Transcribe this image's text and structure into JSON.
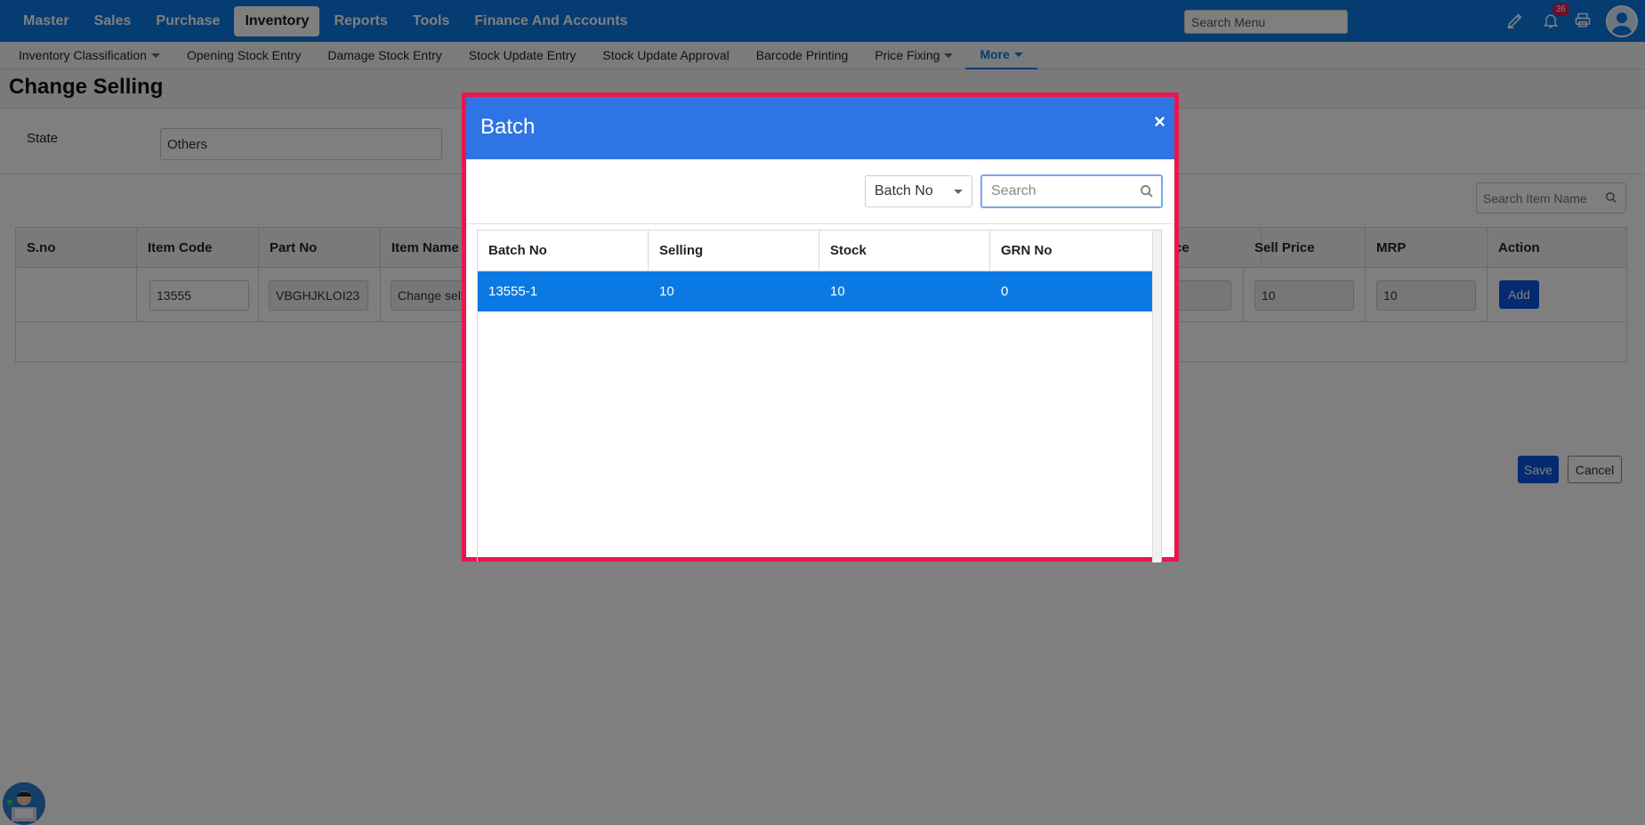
{
  "topnav": {
    "items": [
      "Master",
      "Sales",
      "Purchase",
      "Inventory",
      "Reports",
      "Tools",
      "Finance And Accounts"
    ],
    "active": "Inventory",
    "search_placeholder": "Search Menu",
    "notification_count": "36"
  },
  "subnav": {
    "items": [
      "Inventory Classification",
      "Opening Stock Entry",
      "Damage Stock Entry",
      "Stock Update Entry",
      "Stock Update Approval",
      "Barcode Printing",
      "Price Fixing",
      "More"
    ]
  },
  "page": {
    "title": "Change Selling",
    "state_label": "State",
    "state_value": "Others",
    "search_item_placeholder": "Search Item Name",
    "grid": {
      "headers": [
        "S.no",
        "Item Code",
        "Part No",
        "Item Name",
        "ce",
        "Sell Price",
        "MRP",
        "Action"
      ],
      "row": {
        "item_code": "13555",
        "part_no": "VBGHJKLOI23",
        "item_name": "Change selling",
        "sell_price": "10",
        "mrp": "10",
        "action_label": "Add"
      }
    },
    "save_label": "Save",
    "cancel_label": "Cancel"
  },
  "modal": {
    "title": "Batch",
    "close_label": "×",
    "filter_value": "Batch No",
    "search_placeholder": "Search",
    "headers": [
      "Batch No",
      "Selling",
      "Stock",
      "GRN No"
    ],
    "rows": [
      {
        "batch_no": "13555-1",
        "selling": "10",
        "stock": "10",
        "grn_no": "0"
      }
    ]
  },
  "colors": {
    "nav_blue": "#0b79e3",
    "modal_header": "#2f74e4",
    "modal_border": "#e8174e",
    "button_blue": "#0b55e3",
    "badge": "#e6194b"
  }
}
